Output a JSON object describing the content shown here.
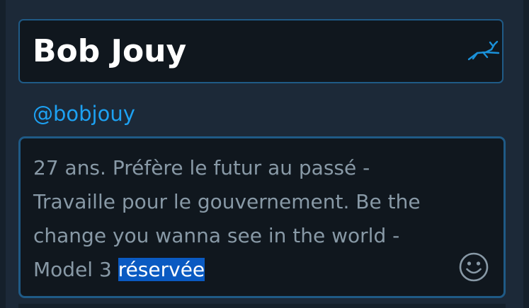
{
  "profile": {
    "name": "Bob Jouy",
    "handle": "@bobjouy",
    "bio_before_selection": "27 ans. Préfère le futur au passé - Travaille pour le gouvernement. Be the change you wanna see in the world - Model 3 ",
    "bio_selected": "réservée"
  },
  "icons": {
    "name_field_icon": "gazelle-icon",
    "bio_field_icon": "emoji-smiley-icon"
  },
  "colors": {
    "background": "#1c2938",
    "field_background": "#10171e",
    "field_border": "#1f5a86",
    "name_text": "#ffffff",
    "handle_text": "#1da1f2",
    "bio_text": "#8899a6",
    "selection_highlight": "#0a5ac2",
    "icon_accent": "#1a91da"
  }
}
